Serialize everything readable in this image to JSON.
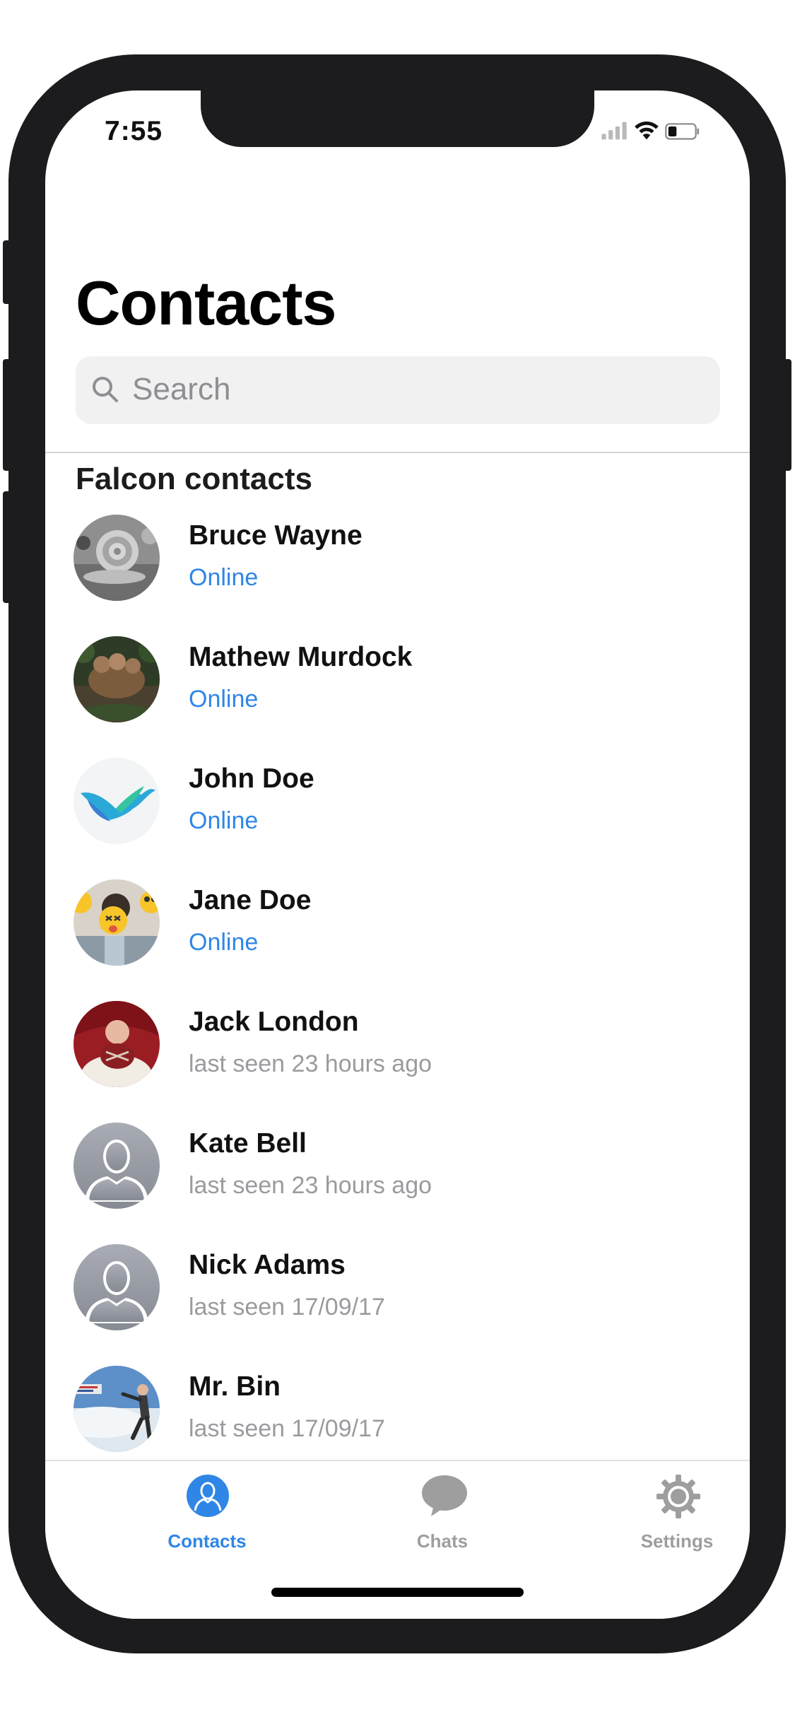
{
  "status_bar": {
    "time": "7:55"
  },
  "header": {
    "title": "Contacts"
  },
  "search": {
    "placeholder": "Search"
  },
  "section": {
    "title": "Falcon contacts"
  },
  "contacts": [
    {
      "name": "Bruce Wayne",
      "status": "Online",
      "online": true,
      "avatar": "photo-snail"
    },
    {
      "name": "Mathew Murdock",
      "status": "Online",
      "online": true,
      "avatar": "photo-forest"
    },
    {
      "name": "John Doe",
      "status": "Online",
      "online": true,
      "avatar": "logo-falcon-bird"
    },
    {
      "name": "Jane Doe",
      "status": "Online",
      "online": true,
      "avatar": "photo-emoji-faces"
    },
    {
      "name": "Jack London",
      "status": "last seen 23 hours ago",
      "online": false,
      "avatar": "photo-baby"
    },
    {
      "name": "Kate Bell",
      "status": "last seen 23 hours ago",
      "online": false,
      "avatar": "placeholder-person"
    },
    {
      "name": "Nick Adams",
      "status": "last seen 17/09/17",
      "online": false,
      "avatar": "placeholder-person"
    },
    {
      "name": "Mr. Bin",
      "status": "last seen 17/09/17",
      "online": false,
      "avatar": "photo-mr-bean"
    }
  ],
  "tabs": [
    {
      "label": "Contacts",
      "icon": "person-icon",
      "active": true
    },
    {
      "label": "Chats",
      "icon": "chat-bubble-icon",
      "active": false
    },
    {
      "label": "Settings",
      "icon": "gear-icon",
      "active": false
    }
  ],
  "colors": {
    "accent": "#2f86e6",
    "secondary_text": "#9b9b9f",
    "inactive_tab": "#9e9e9e"
  }
}
